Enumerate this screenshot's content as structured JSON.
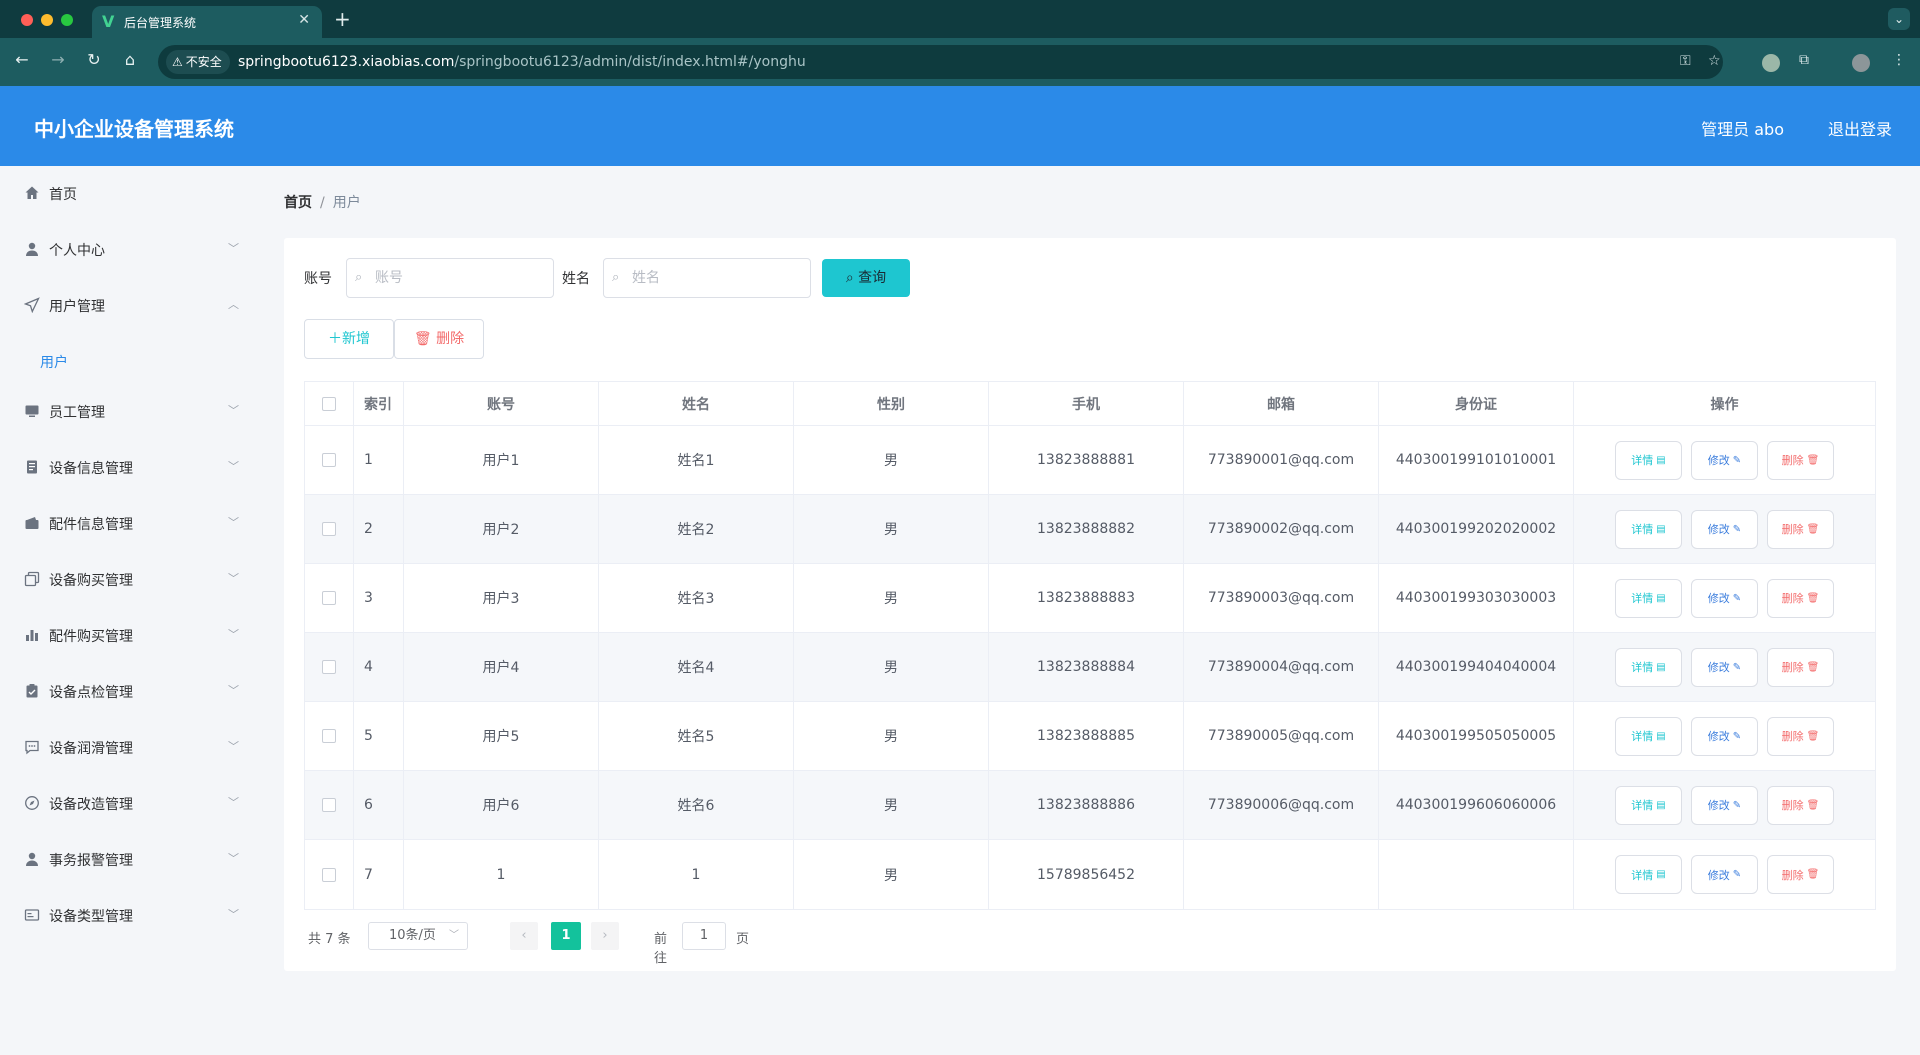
{
  "browser": {
    "tab_title": "后台管理系统",
    "insecure_label": "不安全",
    "url_host": "springbootu6123.xiaobias.com",
    "url_path": "/springbootu6123/admin/dist/index.html#/yonghu"
  },
  "header": {
    "title": "中小企业设备管理系统",
    "admin": "管理员 abo",
    "logout": "退出登录"
  },
  "sidebar": {
    "items": [
      {
        "label": "首页",
        "icon": "home-icon"
      },
      {
        "label": "个人中心",
        "icon": "user-icon"
      },
      {
        "label": "用户管理",
        "icon": "send-icon"
      },
      {
        "label": "用户",
        "icon": ""
      },
      {
        "label": "员工管理",
        "icon": "monitor-icon"
      },
      {
        "label": "设备信息管理",
        "icon": "document-icon"
      },
      {
        "label": "配件信息管理",
        "icon": "wallet-icon"
      },
      {
        "label": "设备购买管理",
        "icon": "copy-icon"
      },
      {
        "label": "配件购买管理",
        "icon": "bar-chart-icon"
      },
      {
        "label": "设备点检管理",
        "icon": "clipboard-icon"
      },
      {
        "label": "设备润滑管理",
        "icon": "chat-icon"
      },
      {
        "label": "设备改造管理",
        "icon": "compass-icon"
      },
      {
        "label": "事务报警管理",
        "icon": "user-icon"
      },
      {
        "label": "设备类型管理",
        "icon": "card-icon"
      }
    ]
  },
  "breadcrumb": {
    "home": "首页",
    "separator": "/",
    "current": "用户"
  },
  "search": {
    "account_label": "账号",
    "account_placeholder": "账号",
    "name_label": "姓名",
    "name_placeholder": "姓名",
    "query_button": "查询"
  },
  "actions": {
    "add": "新增",
    "delete": "删除"
  },
  "table": {
    "headers": [
      "索引",
      "账号",
      "姓名",
      "性别",
      "手机",
      "邮箱",
      "身份证",
      "操作"
    ],
    "ops": {
      "detail": "详情",
      "edit": "修改",
      "remove": "删除"
    },
    "rows": [
      {
        "idx": "1",
        "account": "用户1",
        "name": "姓名1",
        "sex": "男",
        "phone": "13823888881",
        "email": "773890001@qq.com",
        "idcard": "440300199101010001"
      },
      {
        "idx": "2",
        "account": "用户2",
        "name": "姓名2",
        "sex": "男",
        "phone": "13823888882",
        "email": "773890002@qq.com",
        "idcard": "440300199202020002"
      },
      {
        "idx": "3",
        "account": "用户3",
        "name": "姓名3",
        "sex": "男",
        "phone": "13823888883",
        "email": "773890003@qq.com",
        "idcard": "440300199303030003"
      },
      {
        "idx": "4",
        "account": "用户4",
        "name": "姓名4",
        "sex": "男",
        "phone": "13823888884",
        "email": "773890004@qq.com",
        "idcard": "440300199404040004"
      },
      {
        "idx": "5",
        "account": "用户5",
        "name": "姓名5",
        "sex": "男",
        "phone": "13823888885",
        "email": "773890005@qq.com",
        "idcard": "440300199505050005"
      },
      {
        "idx": "6",
        "account": "用户6",
        "name": "姓名6",
        "sex": "男",
        "phone": "13823888886",
        "email": "773890006@qq.com",
        "idcard": "440300199606060006"
      },
      {
        "idx": "7",
        "account": "1",
        "name": "1",
        "sex": "男",
        "phone": "15789856452",
        "email": "",
        "idcard": ""
      }
    ]
  },
  "pagination": {
    "total": "共 7 条",
    "page_size": "10条/页",
    "current_page": "1",
    "goto_label": "前往",
    "jump_value": "1",
    "page_suffix": "页"
  },
  "colors": {
    "header_bg": "#2b8ae8",
    "accent": "#1ec6d0",
    "danger": "#f36b6b",
    "pager_active": "#13c29c"
  }
}
